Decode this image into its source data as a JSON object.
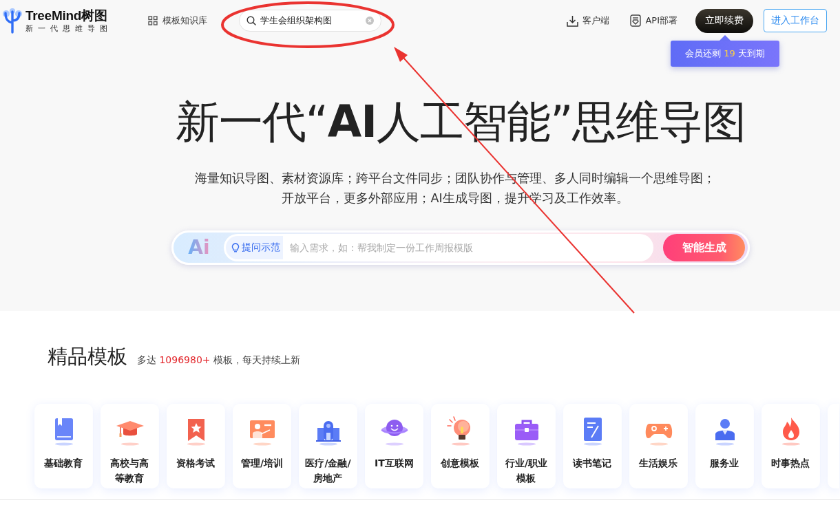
{
  "header": {
    "brand": {
      "name": "TreeMind树图",
      "tagline": "新一代思维导图"
    },
    "nav": [
      {
        "label": "模板知识库"
      }
    ],
    "search": {
      "value": "学生会组织架构图"
    },
    "actions": [
      {
        "kind": "download",
        "label": "客户端"
      },
      {
        "kind": "api",
        "label": "API部署"
      }
    ],
    "renew_button": "立即续费",
    "workspace_button": "进入工作台",
    "tooltip": {
      "before": "会员还剩",
      "days": "19",
      "after": "天到期"
    }
  },
  "hero": {
    "title": "新一代“**AI**人工智能”思维导图",
    "description": [
      "海量知识导图、素材资源库；跨平台文件同步；团队协作与管理、多人同时编辑一个思维导图；",
      "开放平台，更多外部应用；AI生成导图，提升学习及工作效率。"
    ],
    "ai_prompt": {
      "logo": "Ai",
      "example_button": "提问示范",
      "placeholder": "输入需求，如：帮我制定一份工作周报模版",
      "generate_button": "智能生成"
    }
  },
  "templates": {
    "title": "精品模板",
    "count_prefix": "多达",
    "count": "1096980+",
    "count_suffix": "模板，每天持续上新",
    "categories": [
      {
        "label": "基础教育"
      },
      {
        "label": "高校与高等教育"
      },
      {
        "label": "资格考试"
      },
      {
        "label": "管理/培训"
      },
      {
        "label": "医疗/金融/房地产"
      },
      {
        "label": "IT互联网"
      },
      {
        "label": "创意模板"
      },
      {
        "label": "行业/职业模板"
      },
      {
        "label": "读书笔记"
      },
      {
        "label": "生活娱乐"
      },
      {
        "label": "服务业"
      },
      {
        "label": "时事热点"
      }
    ]
  },
  "annotations": {
    "search_highlight": true,
    "arrow": true
  }
}
